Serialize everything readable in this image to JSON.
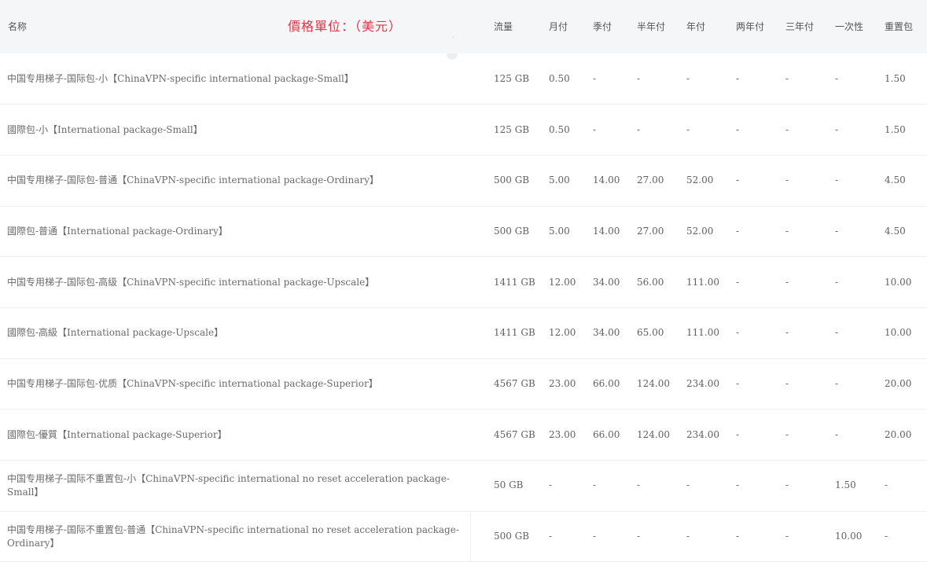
{
  "currency_note": "價格單位：（美元）",
  "headers": {
    "name": "名称",
    "traffic": "流量",
    "monthly": "月付",
    "quarterly": "季付",
    "half_year": "半年付",
    "yearly": "年付",
    "two_year": "两年付",
    "three_year": "三年付",
    "one_time": "一次性",
    "reset_pack": "重置包"
  },
  "rows": [
    {
      "name": "中国专用梯子-国际包-小【ChinaVPN-specific international package-Small】",
      "traffic": "125 GB",
      "monthly": "0.50",
      "quarterly": "-",
      "half_year": "-",
      "yearly": "-",
      "two_year": "-",
      "three_year": "-",
      "one_time": "-",
      "reset_pack": "1.50"
    },
    {
      "name": "國際包-小【International package-Small】",
      "traffic": "125 GB",
      "monthly": "0.50",
      "quarterly": "-",
      "half_year": "-",
      "yearly": "-",
      "two_year": "-",
      "three_year": "-",
      "one_time": "-",
      "reset_pack": "1.50"
    },
    {
      "name": "中国专用梯子-国际包-普通【ChinaVPN-specific international package-Ordinary】",
      "traffic": "500 GB",
      "monthly": "5.00",
      "quarterly": "14.00",
      "half_year": "27.00",
      "yearly": "52.00",
      "two_year": "-",
      "three_year": "-",
      "one_time": "-",
      "reset_pack": "4.50"
    },
    {
      "name": "國際包-普通【International package-Ordinary】",
      "traffic": "500 GB",
      "monthly": "5.00",
      "quarterly": "14.00",
      "half_year": "27.00",
      "yearly": "52.00",
      "two_year": "-",
      "three_year": "-",
      "one_time": "-",
      "reset_pack": "4.50"
    },
    {
      "name": "中国专用梯子-国际包-高级【ChinaVPN-specific international package-Upscale】",
      "traffic": "1411 GB",
      "monthly": "12.00",
      "quarterly": "34.00",
      "half_year": "56.00",
      "yearly": "111.00",
      "two_year": "-",
      "three_year": "-",
      "one_time": "-",
      "reset_pack": "10.00"
    },
    {
      "name": "國際包-高級【International package-Upscale】",
      "traffic": "1411 GB",
      "monthly": "12.00",
      "quarterly": "34.00",
      "half_year": "65.00",
      "yearly": "111.00",
      "two_year": "-",
      "three_year": "-",
      "one_time": "-",
      "reset_pack": "10.00"
    },
    {
      "name": "中国专用梯子-国际包-优质【ChinaVPN-specific international package-Superior】",
      "traffic": "4567 GB",
      "monthly": "23.00",
      "quarterly": "66.00",
      "half_year": "124.00",
      "yearly": "234.00",
      "two_year": "-",
      "three_year": "-",
      "one_time": "-",
      "reset_pack": "20.00"
    },
    {
      "name": "國際包-優質【International package-Superior】",
      "traffic": "4567 GB",
      "monthly": "23.00",
      "quarterly": "66.00",
      "half_year": "124.00",
      "yearly": "234.00",
      "two_year": "-",
      "three_year": "-",
      "one_time": "-",
      "reset_pack": "20.00"
    },
    {
      "name": "中国专用梯子-国际不重置包-小【ChinaVPN-specific international no reset acceleration package-Small】",
      "traffic": "50 GB",
      "monthly": "-",
      "quarterly": "-",
      "half_year": "-",
      "yearly": "-",
      "two_year": "-",
      "three_year": "-",
      "one_time": "1.50",
      "reset_pack": "-"
    },
    {
      "name": "中国专用梯子-国际不重置包-普通【ChinaVPN-specific international no reset acceleration package-Ordinary】",
      "traffic": "500 GB",
      "monthly": "-",
      "quarterly": "-",
      "half_year": "-",
      "yearly": "-",
      "two_year": "-",
      "three_year": "-",
      "one_time": "10.00",
      "reset_pack": "-"
    }
  ]
}
